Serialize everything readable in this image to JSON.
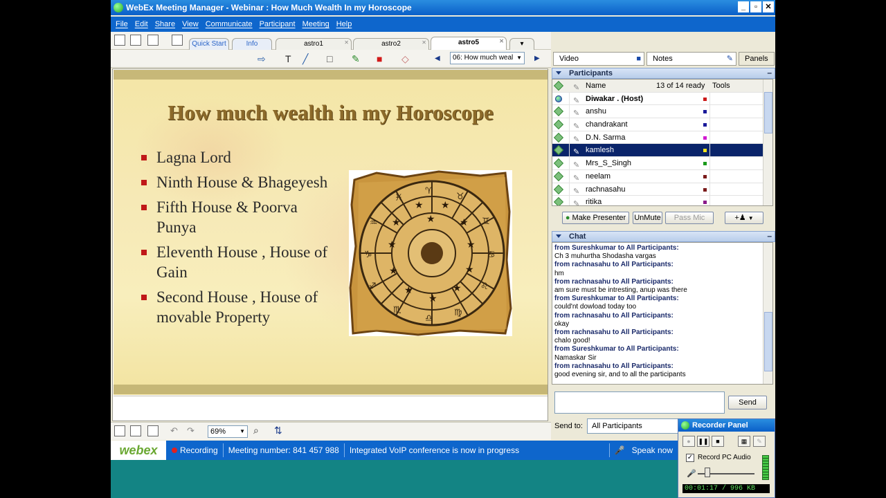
{
  "window": {
    "title": "WebEx Meeting Manager - Webinar : How Much Wealth In my Horoscope"
  },
  "menu": [
    "File",
    "Edit",
    "Share",
    "View",
    "Communicate",
    "Participant",
    "Meeting",
    "Help"
  ],
  "tabs": [
    {
      "label": "Quick Start"
    },
    {
      "label": "Info"
    },
    {
      "label": "astro1"
    },
    {
      "label": "astro2"
    },
    {
      "label": "astro5"
    }
  ],
  "slide_selector": {
    "value": "06: How much weal"
  },
  "slide": {
    "title": "How much wealth in my Horoscope",
    "bullets": [
      "Lagna Lord",
      "Ninth House & Bhageyesh",
      "Fifth House & Poorva Punya",
      "Eleventh House , House of Gain",
      "Second House , House of movable Property"
    ]
  },
  "zoom": {
    "value": "69%"
  },
  "status": {
    "logo": "webex",
    "recording": "Recording",
    "meeting_number": "Meeting number: 841 457 988",
    "voip": "Integrated VoIP conference is now in progress",
    "speak": "Speak now"
  },
  "panels_top": {
    "video": "Video",
    "notes": "Notes",
    "panels": "Panels"
  },
  "participants": {
    "header": "Participants",
    "col_name": "Name",
    "ready": "13 of 14 ready",
    "col_tools": "Tools",
    "rows": [
      {
        "name": "Diwakar . (Host)",
        "color": "#cc1a1a",
        "host": true
      },
      {
        "name": "anshu",
        "color": "#1a1a9a"
      },
      {
        "name": "chandrakant",
        "color": "#1a1a9a"
      },
      {
        "name": "D.N. Sarma",
        "color": "#d21ad2"
      },
      {
        "name": "kamlesh",
        "color": "#f2e41a",
        "selected": true
      },
      {
        "name": "Mrs_S_Singh",
        "color": "#1a9a1a"
      },
      {
        "name": "neelam",
        "color": "#7a1a1a"
      },
      {
        "name": "rachnasahu",
        "color": "#7a1a1a"
      },
      {
        "name": "ritika",
        "color": "#8a1a8a"
      }
    ],
    "buttons": {
      "make_presenter": "Make Presenter",
      "unmute": "UnMute",
      "pass_mic": "Pass Mic"
    }
  },
  "chat": {
    "header": "Chat",
    "lines": [
      {
        "type": "from",
        "text": "from Sureshkumar to All Participants:"
      },
      {
        "type": "msg",
        "text": "Ch 3 muhurtha Shodasha vargas"
      },
      {
        "type": "from",
        "text": "from rachnasahu to All Participants:"
      },
      {
        "type": "msg",
        "text": "hm"
      },
      {
        "type": "from",
        "text": "from rachnasahu to All Participants:"
      },
      {
        "type": "msg",
        "text": " am sure must be intresting, anup was there"
      },
      {
        "type": "from",
        "text": "from Sureshkumar to All Participants:"
      },
      {
        "type": "msg",
        "text": "could'nt dowload today too"
      },
      {
        "type": "from",
        "text": "from rachnasahu to All Participants:"
      },
      {
        "type": "msg",
        "text": "okay"
      },
      {
        "type": "from",
        "text": "from rachnasahu to All Participants:"
      },
      {
        "type": "msg",
        "text": "chalo good!"
      },
      {
        "type": "from",
        "text": "from Sureshkumar to All Participants:"
      },
      {
        "type": "msg",
        "text": "Namaskar Sir"
      },
      {
        "type": "from",
        "text": "from rachnasahu to All Participants:"
      },
      {
        "type": "msg",
        "text": "good evening sir, and to all the participants"
      }
    ],
    "send_label": "Send",
    "send_to_label": "Send to:",
    "send_to_value": "All Participants"
  },
  "recorder": {
    "title": "Recorder Panel",
    "record_pc_audio": "Record PC Audio",
    "time": "00:01:17 / 996 KB"
  }
}
